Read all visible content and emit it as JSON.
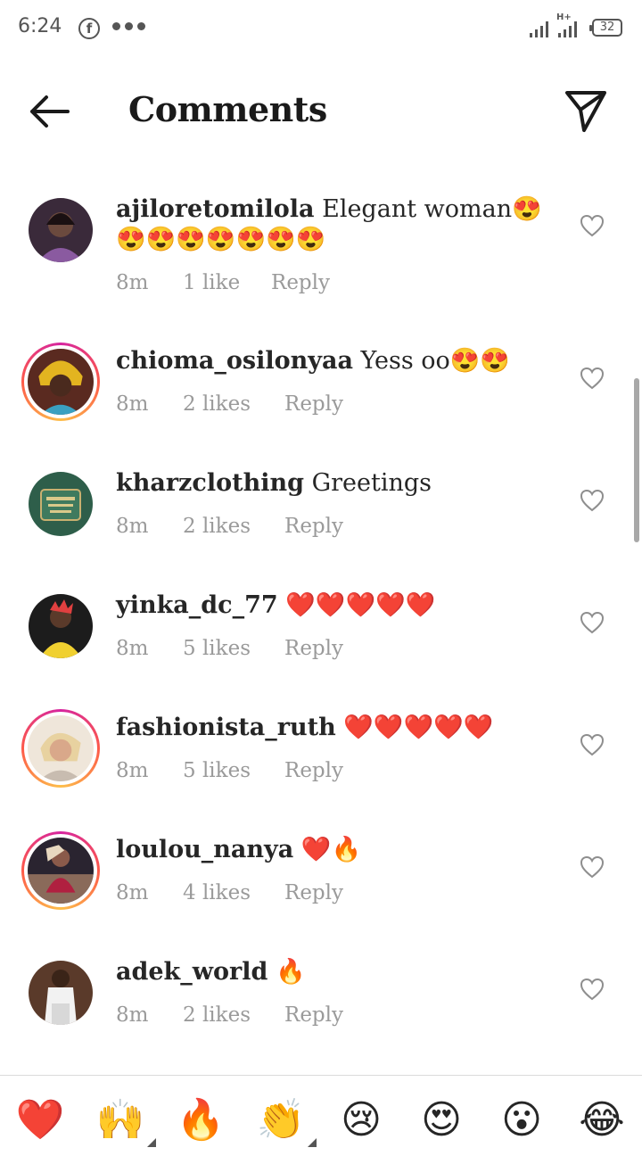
{
  "status_bar": {
    "time": "6:24",
    "facebook_glyph": "f",
    "network": "H+",
    "battery": "32"
  },
  "header": {
    "title": "Comments"
  },
  "comments": [
    {
      "username": "ajiloretomilola",
      "text": "Elegant woman😍😍😍😍😍😍😍😍",
      "time": "8m",
      "likes": "1 like",
      "reply": "Reply",
      "ring": false
    },
    {
      "username": "chioma_osilonyaa",
      "text": "Yess oo😍😍",
      "time": "8m",
      "likes": "2 likes",
      "reply": "Reply",
      "ring": true
    },
    {
      "username": "kharzclothing",
      "text": "Greetings",
      "time": "8m",
      "likes": "2 likes",
      "reply": "Reply",
      "ring": false
    },
    {
      "username": "yinka_dc_77",
      "text": "❤️❤️❤️❤️❤️",
      "time": "8m",
      "likes": "5 likes",
      "reply": "Reply",
      "ring": false
    },
    {
      "username": "fashionista_ruth",
      "text": "❤️❤️❤️❤️❤️",
      "time": "8m",
      "likes": "5 likes",
      "reply": "Reply",
      "ring": true
    },
    {
      "username": "loulou_nanya",
      "text": "❤️🔥",
      "time": "8m",
      "likes": "4 likes",
      "reply": "Reply",
      "ring": true
    },
    {
      "username": "adek_world",
      "text": "🔥",
      "time": "8m",
      "likes": "2 likes",
      "reply": "Reply",
      "ring": false
    }
  ],
  "quick_reactions": [
    "❤️",
    "🙌",
    "🔥",
    "👏",
    "😢",
    "😍",
    "😮",
    "😂"
  ],
  "icons": {
    "back": "arrow-left-icon",
    "send": "paper-plane-icon",
    "like": "heart-outline-icon"
  }
}
